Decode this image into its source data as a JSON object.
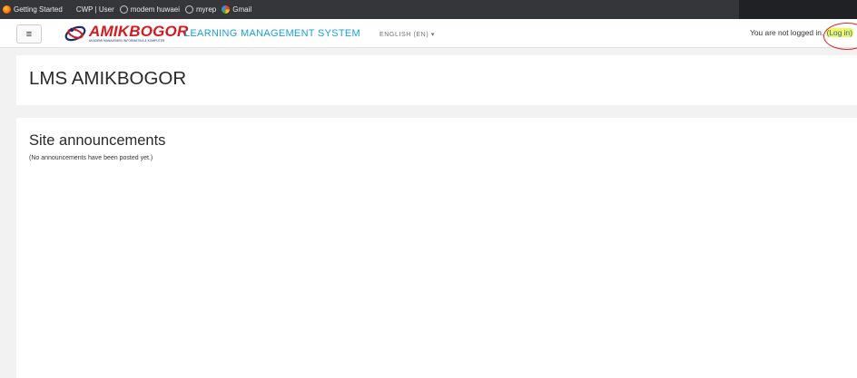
{
  "bookmarks": [
    {
      "label": "Getting Started",
      "icon": "firefox-icon"
    },
    {
      "label": "CWP | User",
      "icon": "none"
    },
    {
      "label": "modem huwaei",
      "icon": "globe-icon"
    },
    {
      "label": "myrep",
      "icon": "globe-icon"
    },
    {
      "label": "Gmail",
      "icon": "google-icon"
    }
  ],
  "navbar": {
    "menu_icon": "≡",
    "logo_text": "AMIKBOGOR",
    "logo_tagline": "AKADEMI MANAJEMEN INFORMATIKA & KOMPUTER",
    "site_title": "LEARNING MANAGEMENT SYSTEM",
    "language": "ENGLISH (EN)",
    "language_caret": "▾",
    "login_status": "You are not logged in.",
    "login_link": "(Log in)"
  },
  "page": {
    "title": "LMS AMIKBOGOR"
  },
  "announcements": {
    "heading": "Site announcements",
    "empty_note": "(No announcements have been posted yet.)"
  },
  "colors": {
    "bookmarks_bar": "#35363a",
    "logo_red": "#d7191f",
    "title_blue": "#1aa0d6",
    "link_blue": "#0f6cbf",
    "highlight_yellow": "#f4f55a",
    "annotation_red": "#e5202a"
  }
}
